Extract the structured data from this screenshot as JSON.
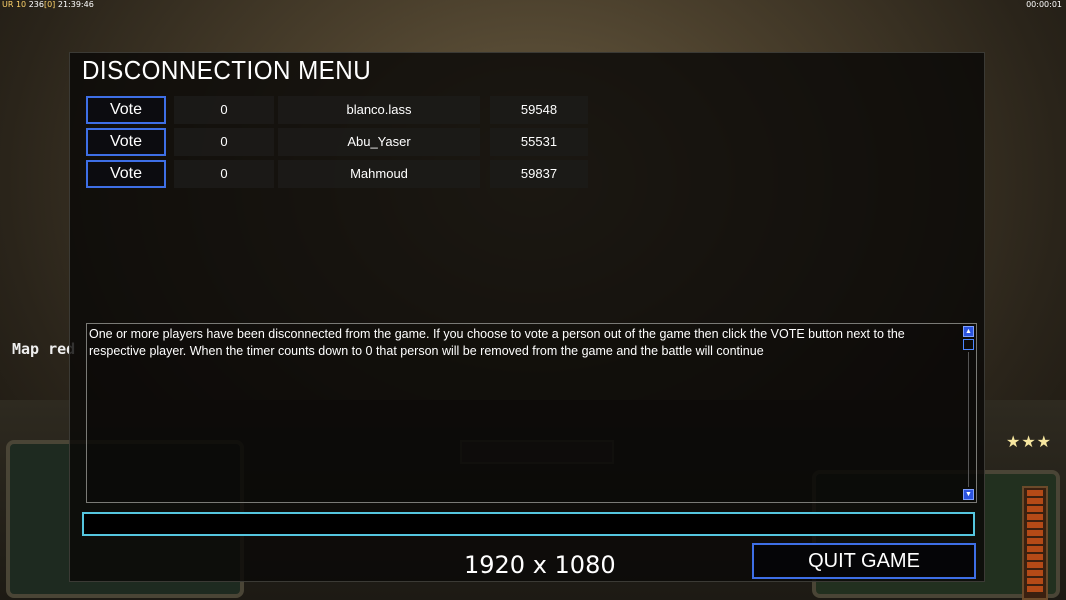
{
  "hud": {
    "top_left_prefix": "UR 10",
    "top_left_value": "236",
    "top_left_bracket": "[0]",
    "top_left_time": "21:39:46",
    "top_right": "00:00:01"
  },
  "background_text": "Map red",
  "dialog": {
    "title": "DISCONNECTION MENU",
    "vote_label": "Vote",
    "players": [
      {
        "votes": "0",
        "name": "blanco.lass",
        "ping": "59548"
      },
      {
        "votes": "0",
        "name": "Abu_Yaser",
        "ping": "55531"
      },
      {
        "votes": "0",
        "name": "Mahmoud",
        "ping": "59837"
      }
    ],
    "message": "One or more players have been disconnected from the game. If you choose to vote a person out of the game then click the VOTE button next to the respective player. When the timer counts down to 0 that person will be removed from the game and the battle will continue",
    "chat_value": "",
    "resolution": "1920 x 1080",
    "quit_label": "QUIT GAME"
  },
  "colors": {
    "button_border": "#3e6fe6",
    "input_border": "#55c6df",
    "scroll_button": "#2c54e0"
  }
}
